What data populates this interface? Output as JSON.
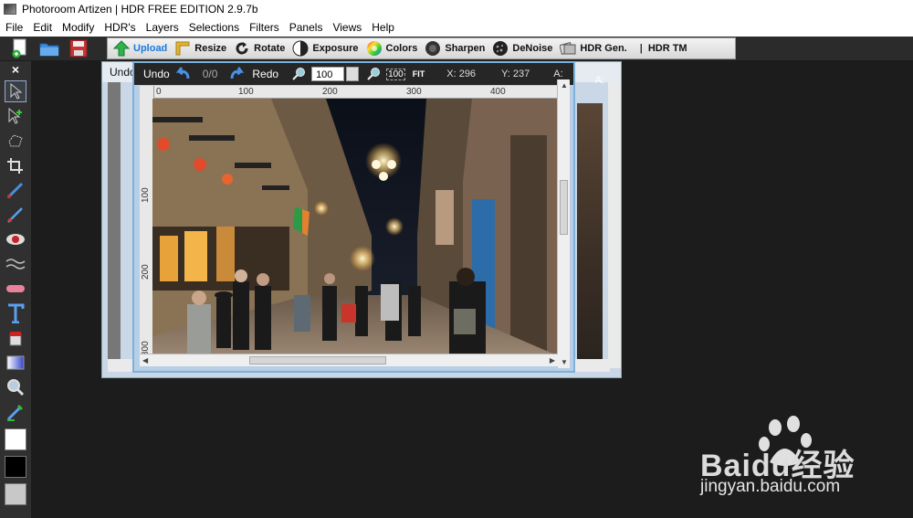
{
  "window": {
    "title": "Photoroom Artizen | HDR FREE EDITION 2.9.7b"
  },
  "menu": [
    "File",
    "Edit",
    "Modify",
    "HDR's",
    "Layers",
    "Selections",
    "Filters",
    "Panels",
    "Views",
    "Help"
  ],
  "toolbar": {
    "upload": "Upload",
    "resize": "Resize",
    "rotate": "Rotate",
    "exposure": "Exposure",
    "colors": "Colors",
    "sharpen": "Sharpen",
    "denoise": "DeNoise",
    "hdr_gen": "HDR Gen.",
    "separator": "|",
    "hdr_tm": "HDR TM"
  },
  "toolbox": {
    "close": "×"
  },
  "back_window": {
    "undo": "Undo",
    "right_label": "A:"
  },
  "doc_toolbar": {
    "undo": "Undo",
    "undo_count": "0/0",
    "redo": "Redo",
    "zoom_value": "100",
    "zoom_reset": "100",
    "fit": "FIT",
    "x_readout": "X: 296",
    "y_readout": "Y: 237",
    "a_readout": "A:"
  },
  "h_ruler": [
    "0",
    "100",
    "200",
    "300",
    "400"
  ],
  "v_ruler": [
    "100",
    "200",
    "300"
  ],
  "watermark": {
    "brand": "Baidu经验",
    "url": "jingyan.baidu.com"
  },
  "colors": {
    "accent_upload": "#1a7ae0",
    "active_border": "#7fb0d8"
  }
}
